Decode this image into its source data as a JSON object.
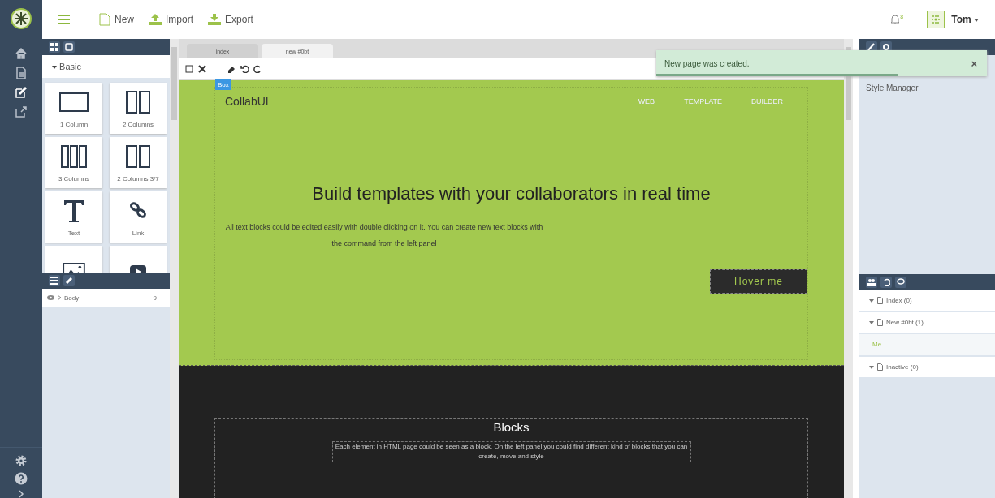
{
  "topbar": {
    "actions": [
      {
        "label": "New",
        "kind": "new"
      },
      {
        "label": "Import",
        "kind": "import"
      },
      {
        "label": "Export",
        "kind": "export"
      }
    ],
    "notifications": "8",
    "user": "Tom"
  },
  "rail": {
    "items": [
      {
        "kind": "home",
        "selected": false
      },
      {
        "kind": "page",
        "selected": false
      },
      {
        "kind": "edit",
        "selected": true
      },
      {
        "kind": "open",
        "selected": false
      }
    ]
  },
  "blocks_panel": {
    "category": "Basic",
    "expanded": true,
    "blocks": [
      {
        "label": "1 Column",
        "kind": "col1"
      },
      {
        "label": "2 Columns",
        "kind": "col2"
      },
      {
        "label": "3 Columns",
        "kind": "col3"
      },
      {
        "label": "2 Columns 3/7",
        "kind": "col37"
      },
      {
        "label": "Text",
        "kind": "text"
      },
      {
        "label": "Link",
        "kind": "link"
      },
      {
        "kind": "image"
      },
      {
        "kind": "video"
      }
    ]
  },
  "layers": [
    {
      "name": "Body",
      "count": "9"
    }
  ],
  "tabs": [
    {
      "label": "index",
      "selected": false
    },
    {
      "label": "new #0bt",
      "selected": true
    }
  ],
  "canvas": {
    "badge": "Box",
    "brand": "CollabUI",
    "nav": [
      "WEB",
      "TEMPLATE",
      "BUILDER"
    ],
    "heading": "Build templates with your collaborators in real time",
    "text": "All text blocks could be edited easily with double clicking on it. You can create new text blocks with the command from the left panel",
    "button": "Hover me",
    "section_title": "Blocks",
    "section_text": "Each element in HTML page could be seen as a block. On the left panel you could find different kind of blocks that you can create, move and style"
  },
  "toast": {
    "message": "New page was created.",
    "close": "×",
    "level": 0.73
  },
  "style_manager": {
    "title": "Style Manager"
  },
  "pages": [
    {
      "label": "Index (0)",
      "expanded": true
    },
    {
      "label": "New #0bt (1)",
      "expanded": true,
      "users": [
        "Me"
      ]
    },
    {
      "label": "Inactive (0)",
      "expanded": true
    }
  ]
}
